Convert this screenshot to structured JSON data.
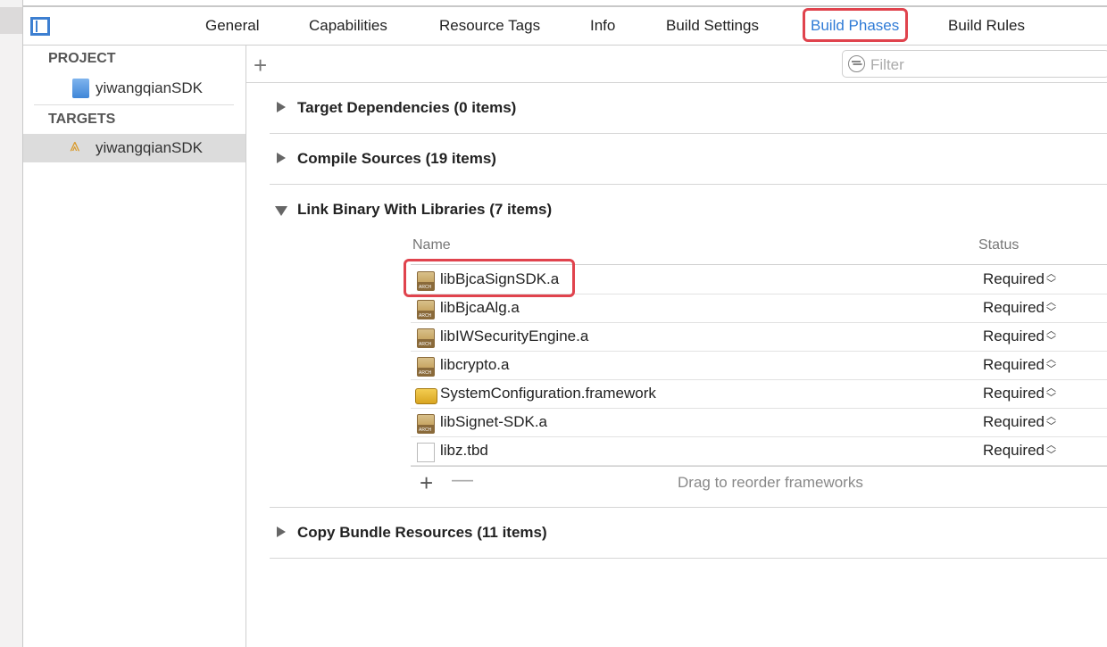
{
  "tabs": [
    {
      "label": "General",
      "active": false
    },
    {
      "label": "Capabilities",
      "active": false
    },
    {
      "label": "Resource Tags",
      "active": false
    },
    {
      "label": "Info",
      "active": false
    },
    {
      "label": "Build Settings",
      "active": false
    },
    {
      "label": "Build Phases",
      "active": true
    },
    {
      "label": "Build Rules",
      "active": false
    }
  ],
  "sidebar": {
    "project_header": "PROJECT",
    "project_item": "yiwangqianSDK",
    "targets_header": "TARGETS",
    "target_item": "yiwangqianSDK"
  },
  "toolbar": {
    "add_label": "+",
    "filter_placeholder": "Filter"
  },
  "phases": [
    {
      "title": "Target Dependencies (0 items)",
      "expanded": false
    },
    {
      "title": "Compile Sources (19 items)",
      "expanded": false
    },
    {
      "title": "Link Binary With Libraries (7 items)",
      "expanded": true
    },
    {
      "title": "Copy Bundle Resources (11 items)",
      "expanded": false
    }
  ],
  "libraries": {
    "col_name": "Name",
    "col_status": "Status",
    "rows": [
      {
        "name": "libBjcaSignSDK.a",
        "status": "Required",
        "icon": "archive"
      },
      {
        "name": "libBjcaAlg.a",
        "status": "Required",
        "icon": "archive"
      },
      {
        "name": "libIWSecurityEngine.a",
        "status": "Required",
        "icon": "archive"
      },
      {
        "name": "libcrypto.a",
        "status": "Required",
        "icon": "archive"
      },
      {
        "name": "SystemConfiguration.framework",
        "status": "Required",
        "icon": "framework"
      },
      {
        "name": "libSignet-SDK.a",
        "status": "Required",
        "icon": "archive"
      },
      {
        "name": "libz.tbd",
        "status": "Required",
        "icon": "document"
      }
    ],
    "add_label": "+",
    "remove_label": "—",
    "hint": "Drag to reorder frameworks"
  },
  "colors": {
    "accent": "#2f7bd6",
    "highlight": "#e0434d"
  }
}
